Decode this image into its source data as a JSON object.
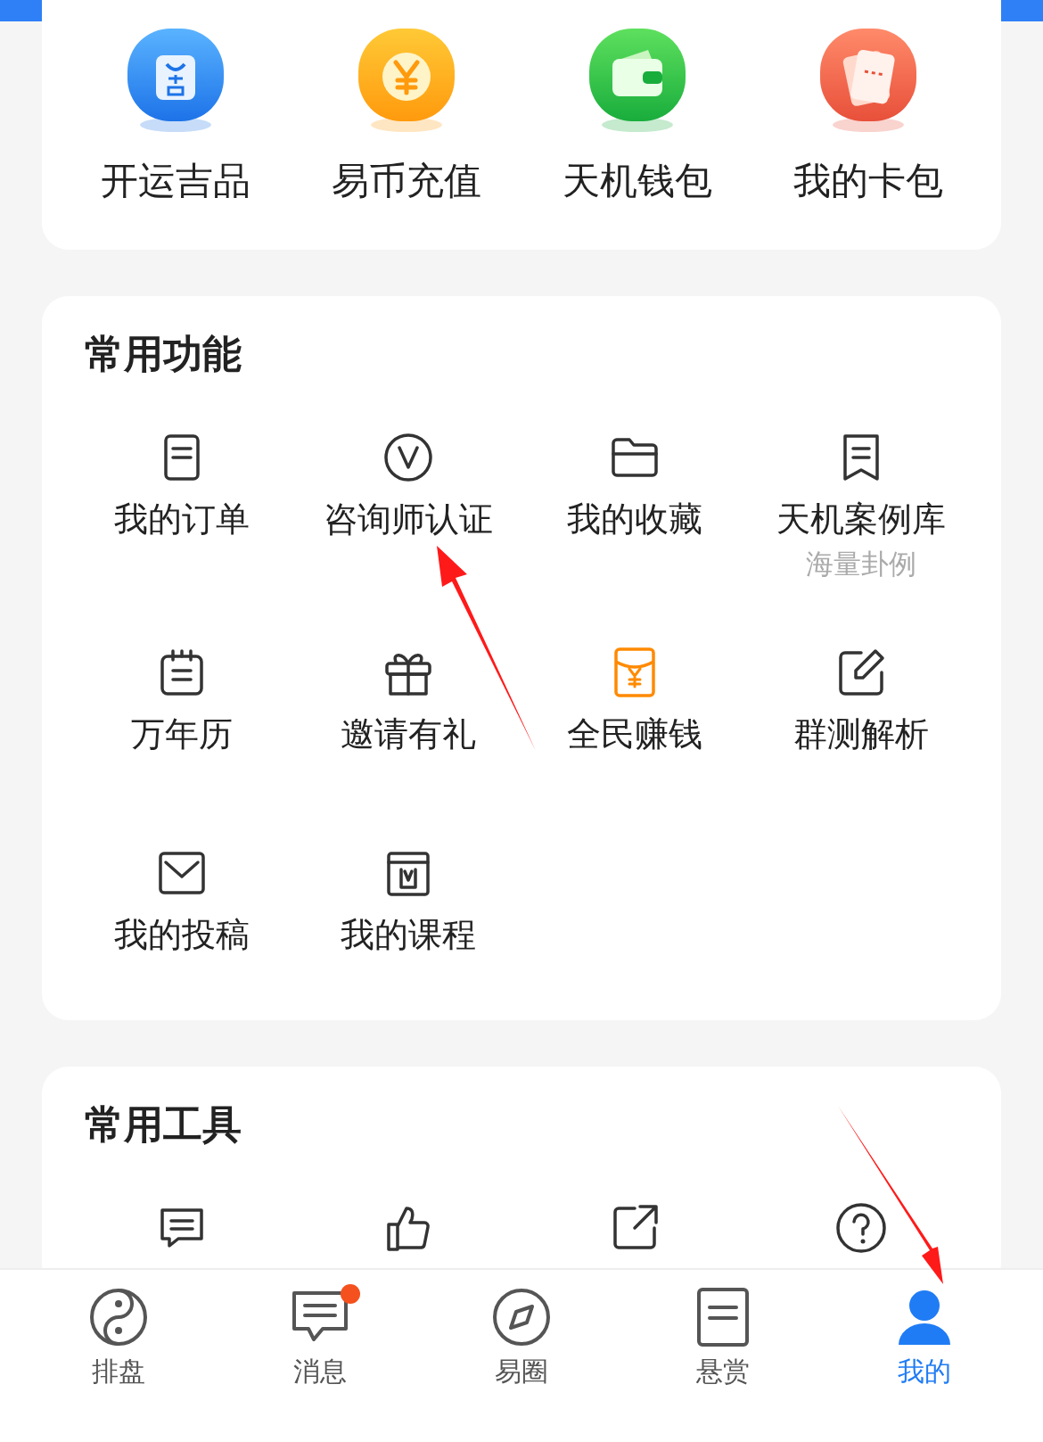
{
  "shortcuts": [
    {
      "label": "开运吉品",
      "kind": "bag"
    },
    {
      "label": "易币充值",
      "kind": "coin"
    },
    {
      "label": "天机钱包",
      "kind": "wallet"
    },
    {
      "label": "我的卡包",
      "kind": "ticket"
    }
  ],
  "functions": {
    "title": "常用功能",
    "items": [
      {
        "label": "我的订单",
        "kind": "order"
      },
      {
        "label": "咨询师认证",
        "kind": "verify"
      },
      {
        "label": "我的收藏",
        "kind": "folder"
      },
      {
        "label": "天机案例库",
        "subtitle": "海量卦例",
        "kind": "cases"
      },
      {
        "label": "万年历",
        "kind": "calendar"
      },
      {
        "label": "邀请有礼",
        "kind": "gift"
      },
      {
        "label": "全民赚钱",
        "kind": "money"
      },
      {
        "label": "群测解析",
        "kind": "edit"
      },
      {
        "label": "我的投稿",
        "kind": "mail"
      },
      {
        "label": "我的课程",
        "kind": "course"
      }
    ]
  },
  "tools": {
    "title": "常用工具",
    "items": [
      {
        "kind": "chat"
      },
      {
        "kind": "like"
      },
      {
        "kind": "share"
      },
      {
        "kind": "help"
      }
    ]
  },
  "tab_bar": [
    {
      "label": "排盘",
      "kind": "taiji",
      "selected": false,
      "badge": false
    },
    {
      "label": "消息",
      "kind": "message",
      "selected": false,
      "badge": true
    },
    {
      "label": "易圈",
      "kind": "compass",
      "selected": false,
      "badge": false
    },
    {
      "label": "悬赏",
      "kind": "reward",
      "selected": false,
      "badge": false
    },
    {
      "label": "我的",
      "kind": "me",
      "selected": true,
      "badge": false
    }
  ]
}
